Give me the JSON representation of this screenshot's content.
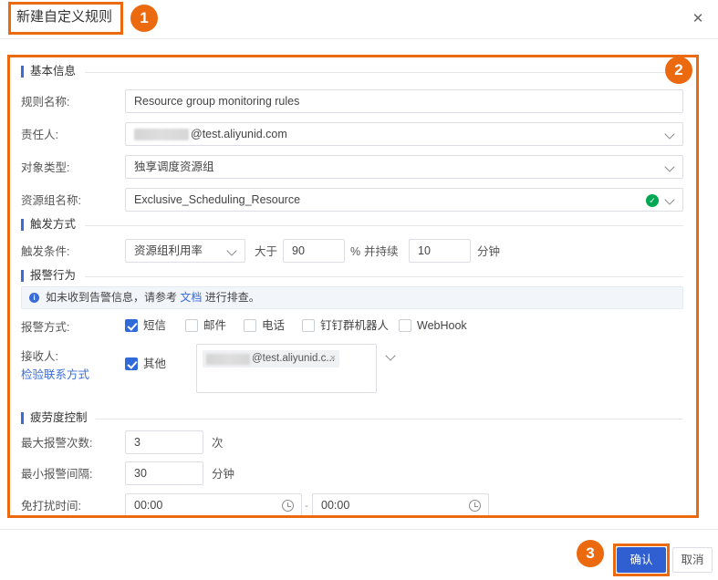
{
  "dialog": {
    "title": "新建自定义规则",
    "close_icon": "close-icon",
    "badges": {
      "one": "1",
      "two": "2",
      "three": "3"
    }
  },
  "sections": {
    "basic": {
      "title": "基本信息",
      "rule_name": {
        "label": "规则名称:",
        "value": "Resource group monitoring rules"
      },
      "owner": {
        "label": "责任人:",
        "value": "@test.aliyunid.com",
        "masked": true
      },
      "object_type": {
        "label": "对象类型:",
        "value": "独享调度资源组"
      },
      "resource_group": {
        "label": "资源组名称:",
        "value": "Exclusive_Scheduling_Resource",
        "status_icon": "check-circle-icon"
      }
    },
    "trigger": {
      "title": "触发方式",
      "condition_label": "触发条件:",
      "metric": "资源组利用率",
      "operator": "大于",
      "threshold": "90",
      "percent_unit": "%",
      "duration_prefix": "并持续",
      "duration": "10",
      "duration_unit": "分钟"
    },
    "alarm": {
      "title": "报警行为",
      "banner_prefix": "如未收到告警信息，请参考 ",
      "banner_link": "文档",
      "banner_suffix": " 进行排查。",
      "method_label": "报警方式:",
      "methods": [
        {
          "label": "短信",
          "checked": true
        },
        {
          "label": "邮件",
          "checked": false
        },
        {
          "label": "电话",
          "checked": false
        },
        {
          "label": "钉钉群机器人",
          "checked": false
        },
        {
          "label": "WebHook",
          "checked": false
        }
      ],
      "receiver_label": "接收人:",
      "receiver_link": "检验联系方式",
      "other_label": "其他",
      "other_checked": true,
      "receiver_tag": "@test.aliyunid.c...",
      "tag_remove": "×"
    },
    "fatigue": {
      "title": "疲劳度控制",
      "max_count": {
        "label": "最大报警次数:",
        "value": "3",
        "unit": "次"
      },
      "min_interval": {
        "label": "最小报警间隔:",
        "value": "30",
        "unit": "分钟"
      },
      "dnd": {
        "label": "免打扰时间:",
        "start": "00:00",
        "end": "00:00",
        "separator": "-",
        "icon": "clock-icon"
      }
    }
  },
  "footer": {
    "confirm_label": "确认",
    "cancel_label": "取消"
  },
  "colors": {
    "highlight": "#ec6a0f",
    "primary": "#2f5fd0",
    "section_bar": "#3a6bd6",
    "success": "#00a854"
  }
}
